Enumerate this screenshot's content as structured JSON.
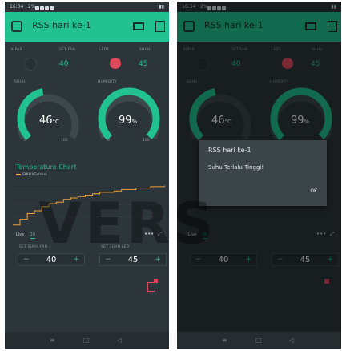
{
  "status_bar": {
    "time": "16:34 · 2%"
  },
  "app": {
    "title": "RSS hari ke-1"
  },
  "widgets": {
    "labels": [
      "KIPAS",
      "SET FAN",
      "LED1",
      "SUHU",
      "SUHU",
      "HUMIDITY"
    ],
    "set_fan_value": "40",
    "set_temp_value": "45",
    "gauge_temp": {
      "value": "46",
      "unit": "°C",
      "min": "0",
      "max": "100",
      "fraction": 0.46
    },
    "gauge_humidity": {
      "value": "99",
      "unit": "%",
      "min": "0",
      "max": "100",
      "fraction": 0.99
    }
  },
  "chart": {
    "title": "Temperature Chart",
    "legend": "SUHU/Celcius",
    "tabs": {
      "live": "Live",
      "1h": "1h"
    }
  },
  "chart_data": {
    "type": "line",
    "title": "Temperature Chart",
    "series": [
      {
        "name": "SUHU/Celcius",
        "values": [
          18,
          22,
          26,
          28,
          31,
          33,
          34,
          36,
          37,
          38,
          39,
          40,
          41,
          41,
          42,
          43,
          43,
          44,
          44,
          45,
          45,
          46
        ]
      }
    ]
  },
  "steppers": {
    "fan": {
      "label": "SET SUHU FAN",
      "value": "40"
    },
    "led": {
      "label": "SET SUHU LED",
      "value": "45"
    }
  },
  "dialog": {
    "title": "RSS hari ke-1",
    "message": "Suhu Terlalu Tinggi!",
    "ok": "OK"
  },
  "watermark": "VERS",
  "colors": {
    "accent": "#21c28f",
    "background": "#2c3539",
    "led_on": "#e0495c",
    "chart_line": "#f0a23b"
  }
}
